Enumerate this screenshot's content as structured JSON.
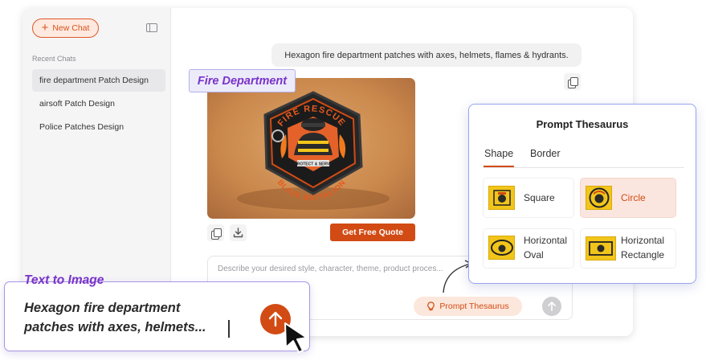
{
  "sidebar": {
    "new_chat_label": "New Chat",
    "recent_title": "Recent Chats",
    "items": [
      {
        "label": "fire department Patch Design"
      },
      {
        "label": "airsoft Patch Design"
      },
      {
        "label": "Police Patches Design"
      }
    ]
  },
  "chat": {
    "user_message": "Hexagon fire department patches with axes, helmets, flames & hydrants.",
    "quote_button": "Get Free Quote",
    "input_placeholder": "Describe your desired style, character, theme, product proces...",
    "thesaurus_button": "Prompt Thesaurus"
  },
  "floating_label": "Fire Department",
  "patch_image": {
    "top_text": "FIRE RESCUE",
    "bottom_text": "BLAZE BATTALION",
    "banner_text": "PROTECT & SERVE"
  },
  "thesaurus_panel": {
    "title": "Prompt Thesaurus",
    "tabs": [
      {
        "label": "Shape"
      },
      {
        "label": "Border"
      }
    ],
    "active_tab": "Shape",
    "options": [
      {
        "label": "Square",
        "icon": "square-patch-thumb",
        "selected": false
      },
      {
        "label": "Circle",
        "icon": "circle-patch-thumb",
        "selected": true
      },
      {
        "label": "Horizontal Oval",
        "line1": "Horizontal",
        "line2": "Oval",
        "icon": "horizontal-oval-patch-thumb",
        "selected": false
      },
      {
        "label": "Horizontal Rectangle",
        "line1": "Horizontal",
        "line2": "Rectangle",
        "icon": "horizontal-rectangle-patch-thumb",
        "selected": false
      }
    ]
  },
  "text_to_image": {
    "label": "Text to Image",
    "line1": "Hexagon fire department",
    "line2": "patches with axes, helmets..."
  },
  "colors": {
    "accent": "#d24b14",
    "purple": "#7a33c9",
    "panel_border": "#97a4f0"
  }
}
